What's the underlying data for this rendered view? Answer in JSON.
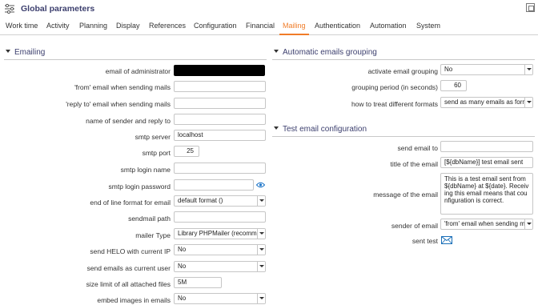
{
  "app": {
    "title": "Global parameters"
  },
  "tabs": [
    {
      "label": "Work time"
    },
    {
      "label": "Activity"
    },
    {
      "label": "Planning"
    },
    {
      "label": "Display"
    },
    {
      "label": "References"
    },
    {
      "label": "Configuration"
    },
    {
      "label": "Financial"
    },
    {
      "label": "Mailing",
      "active": true
    },
    {
      "label": "Authentication"
    },
    {
      "label": "Automation"
    },
    {
      "label": "System"
    }
  ],
  "colors": {
    "accent": "#f07c28",
    "heading": "#3c3f6e"
  },
  "emailing": {
    "title": "Emailing",
    "admin_email": {
      "label": "email of administrator",
      "value": ""
    },
    "from_email": {
      "label": "'from' email when sending mails",
      "value": ""
    },
    "reply_to": {
      "label": "'reply to' email when sending mails",
      "value": ""
    },
    "sender_name": {
      "label": "name of sender and reply to",
      "value": ""
    },
    "smtp_server": {
      "label": "smtp server",
      "value": "localhost"
    },
    "smtp_port": {
      "label": "smtp port",
      "value": "25"
    },
    "smtp_login": {
      "label": "smtp login name",
      "value": ""
    },
    "smtp_password": {
      "label": "smtp login password",
      "value": ""
    },
    "eol_format": {
      "label": "end of line format for email",
      "value": "default format ()"
    },
    "sendmail_path": {
      "label": "sendmail path",
      "value": ""
    },
    "mailer_type": {
      "label": "mailer Type",
      "value": "Library PHPMailer (recommended)"
    },
    "helo_ip": {
      "label": "send HELO with current IP",
      "value": "No"
    },
    "as_current_user": {
      "label": "send emails as current user",
      "value": "No"
    },
    "size_limit": {
      "label": "size limit of all attached files",
      "value": "5M"
    },
    "embed_images": {
      "label": "embed images in emails",
      "value": "No"
    }
  },
  "grouping": {
    "title": "Automatic emails grouping",
    "activate": {
      "label": "activate email grouping",
      "value": "No"
    },
    "period": {
      "label": "grouping period (in seconds)",
      "value": "60"
    },
    "formats": {
      "label": "how to treat different formats",
      "value": "send as many emails as formats"
    }
  },
  "test": {
    "title": "Test email configuration",
    "send_to": {
      "label": "send email to",
      "value": ""
    },
    "email_title": {
      "label": "title of the email",
      "value": "[${dbName}] test email sent"
    },
    "message": {
      "label": "message of the email",
      "value": "This is a test email sent from ${dbName} at ${date}. Receiving this email means that counfiguration is correct."
    },
    "sender": {
      "label": "sender of email",
      "value": "'from' email when sending mails"
    },
    "sent_test": {
      "label": "sent test"
    }
  }
}
